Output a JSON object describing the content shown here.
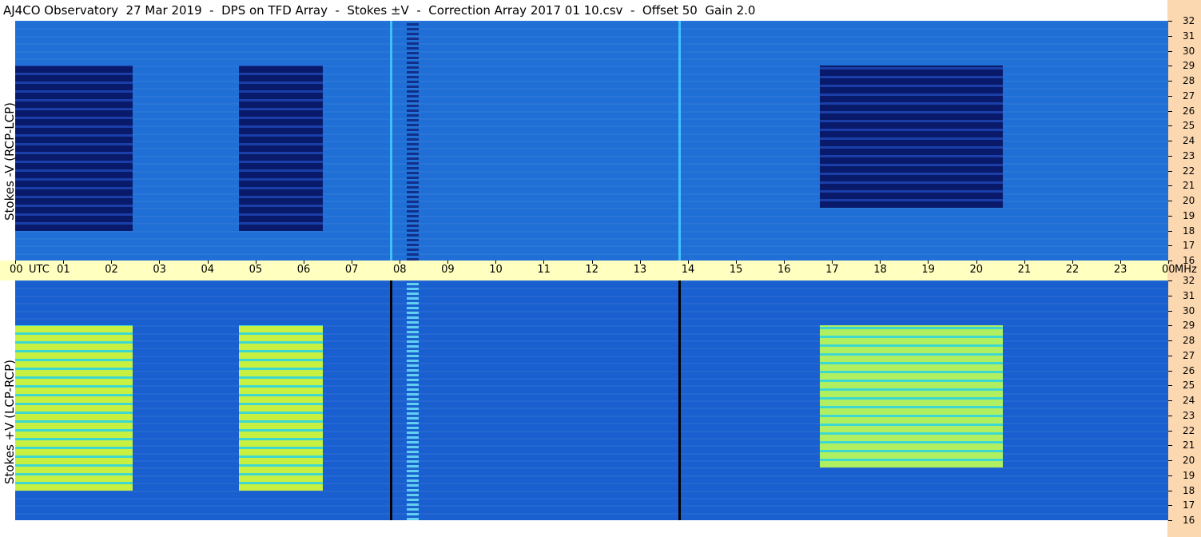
{
  "title": "AJ4CO Observatory  27 Mar 2019  -  DPS on TFD Array  -  Stokes ±V  -  Correction Array 2017 01 10.csv  -  Offset 50  Gain 2.0",
  "chart_data": [
    {
      "type": "heatmap",
      "title": "AJ4CO Observatory  27 Mar 2019  -  DPS on TFD Array  -  Stokes ±V  -  Correction Array 2017 01 10.csv  -  Offset 50  Gain 2.0",
      "panel": "top",
      "ylabel": "Stokes -V (RCP-LCP)",
      "xlabel": "UTC",
      "yunit": "MHz",
      "x_ticks": [
        "00",
        "01",
        "02",
        "03",
        "04",
        "05",
        "06",
        "07",
        "08",
        "09",
        "10",
        "11",
        "12",
        "13",
        "14",
        "15",
        "16",
        "17",
        "18",
        "19",
        "20",
        "21",
        "22",
        "23",
        "00"
      ],
      "y_ticks": [
        16,
        17,
        18,
        19,
        20,
        21,
        22,
        23,
        24,
        25,
        26,
        27,
        28,
        29,
        30,
        31,
        32
      ],
      "ylim": [
        16,
        32
      ],
      "xlim_hours": [
        0,
        24
      ],
      "features": [
        {
          "kind": "strong polarized region",
          "x": [
            0.0,
            2.45
          ],
          "y": [
            18,
            29
          ],
          "color": "#0a1a6a"
        },
        {
          "kind": "strong polarized region",
          "x": [
            4.65,
            6.4
          ],
          "y": [
            18,
            29
          ],
          "color": "#0a1a6a"
        },
        {
          "kind": "strong polarized region",
          "x": [
            16.75,
            20.55
          ],
          "y": [
            19.5,
            29
          ],
          "color": "#0a1a6a"
        },
        {
          "kind": "vertical line",
          "x": 7.8,
          "color": "#40c0ff"
        },
        {
          "kind": "vertical line",
          "x": 13.8,
          "color": "#40c0ff"
        },
        {
          "kind": "interference band",
          "x": [
            8.15,
            8.4
          ],
          "color": "#10308a"
        }
      ]
    },
    {
      "type": "heatmap",
      "panel": "bottom",
      "ylabel": "Stokes +V (LCP-RCP)",
      "xlabel": "UTC",
      "yunit": "MHz",
      "x_ticks": [
        "00",
        "01",
        "02",
        "03",
        "04",
        "05",
        "06",
        "07",
        "08",
        "09",
        "10",
        "11",
        "12",
        "13",
        "14",
        "15",
        "16",
        "17",
        "18",
        "19",
        "20",
        "21",
        "22",
        "23",
        "00"
      ],
      "y_ticks": [
        16,
        17,
        18,
        19,
        20,
        21,
        22,
        23,
        24,
        25,
        26,
        27,
        28,
        29,
        30,
        31,
        32
      ],
      "ylim": [
        16,
        32
      ],
      "xlim_hours": [
        0,
        24
      ],
      "features": [
        {
          "kind": "strong polarized region",
          "x": [
            0.0,
            2.45
          ],
          "y": [
            18,
            29
          ],
          "color": "#c8f040"
        },
        {
          "kind": "strong polarized region",
          "x": [
            4.65,
            6.4
          ],
          "y": [
            18,
            29
          ],
          "color": "#c8f040"
        },
        {
          "kind": "strong polarized region",
          "x": [
            16.75,
            20.55
          ],
          "y": [
            19.5,
            29
          ],
          "color": "#b0f060"
        },
        {
          "kind": "vertical line",
          "x": 7.8,
          "color": "#000000"
        },
        {
          "kind": "vertical line",
          "x": 13.8,
          "color": "#000000"
        },
        {
          "kind": "interference band",
          "x": [
            8.15,
            8.4
          ],
          "color": "#60d0f0"
        }
      ]
    }
  ],
  "axis": {
    "utc_label": "UTC",
    "mhz_label": "MHz"
  },
  "colors": {
    "background_blue": "#1f6fd6",
    "axis_band": "#ffffc0",
    "right_strip": "#fcd8b0"
  }
}
